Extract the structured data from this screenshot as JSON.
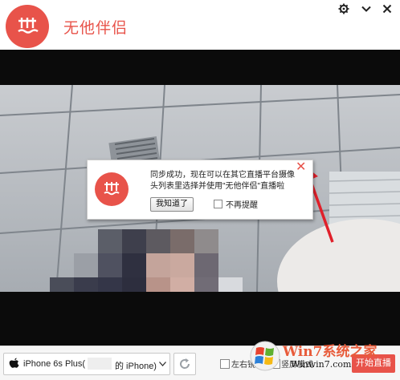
{
  "app": {
    "title": "无他伴侣"
  },
  "window_controls": {
    "settings_icon": "gear-icon",
    "dropdown_icon": "chevron-down-icon",
    "close_icon": "close-icon"
  },
  "dialog": {
    "message_line1": "同步成功，现在可以在其它直播平台摄像",
    "message_line2": "头列表里选择并使用\"无他伴侣\"直播啦",
    "ok_label": "我知道了",
    "no_remind_label": "不再提醒",
    "close_glyph": "✕"
  },
  "toolbar": {
    "device_prefix": "iPhone 6s Plus(",
    "device_suffix": "的 iPhone)",
    "mirror_label": "左右镜",
    "portrait_label": "竖屏模式",
    "live_label": "开始直播"
  },
  "watermark": {
    "brand": "Win7系统之家",
    "url": "Winwin7.com"
  },
  "colors": {
    "accent": "#e8534a",
    "arrow": "#e0202a"
  }
}
